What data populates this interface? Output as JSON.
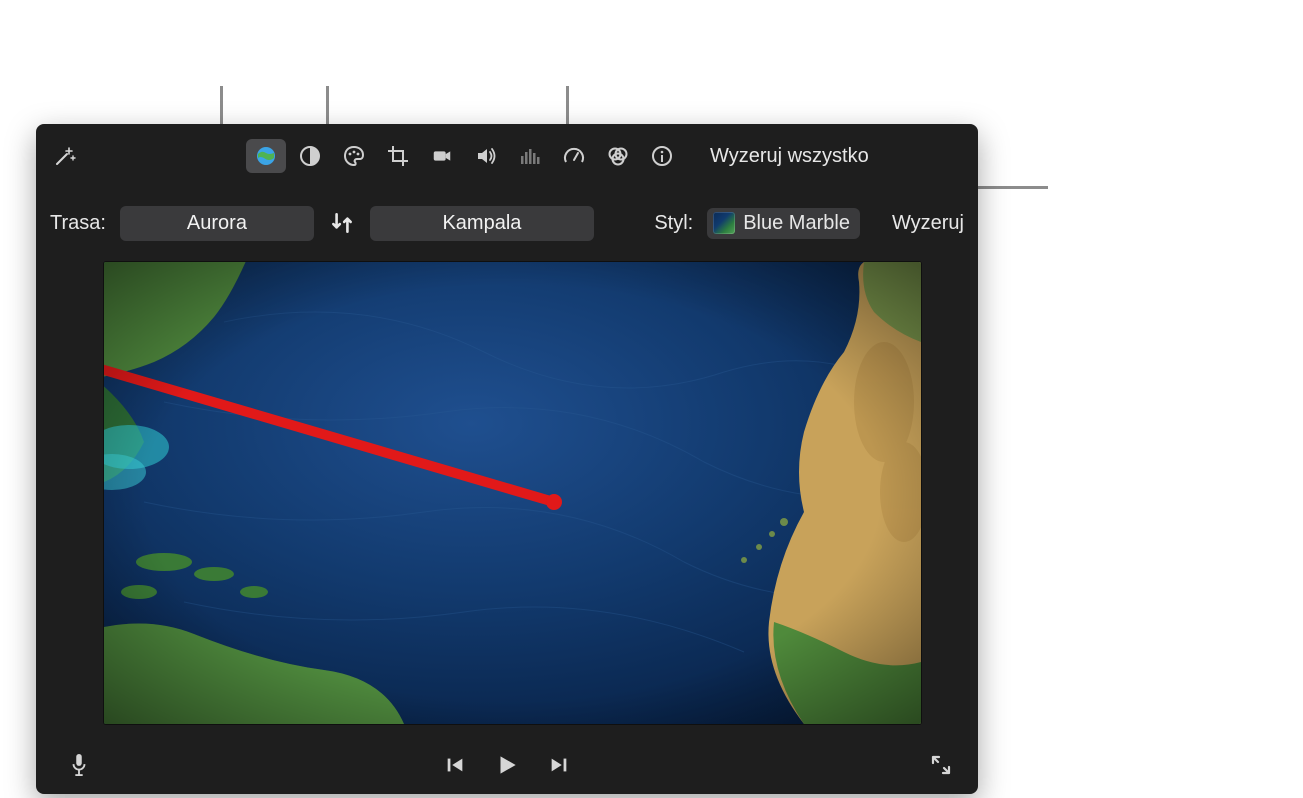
{
  "toolbar": {
    "reset_all_label": "Wyzeruj wszystko"
  },
  "route": {
    "label": "Trasa:",
    "from": "Aurora",
    "to": "Kampala"
  },
  "style": {
    "label": "Styl:",
    "value": "Blue Marble",
    "reset_label": "Wyzeruj"
  },
  "icons": {
    "magic": "magic-wand-icon",
    "globe": "globe-icon",
    "contrast": "contrast-icon",
    "palette": "palette-icon",
    "crop": "crop-icon",
    "camera": "camera-icon",
    "volume": "volume-icon",
    "eq": "equalizer-icon",
    "speed": "speedometer-icon",
    "filters": "filters-icon",
    "info": "info-icon",
    "swap": "swap-icon",
    "mic": "microphone-icon",
    "prev": "previous-icon",
    "play": "play-icon",
    "next": "next-icon",
    "expand": "expand-icon"
  }
}
